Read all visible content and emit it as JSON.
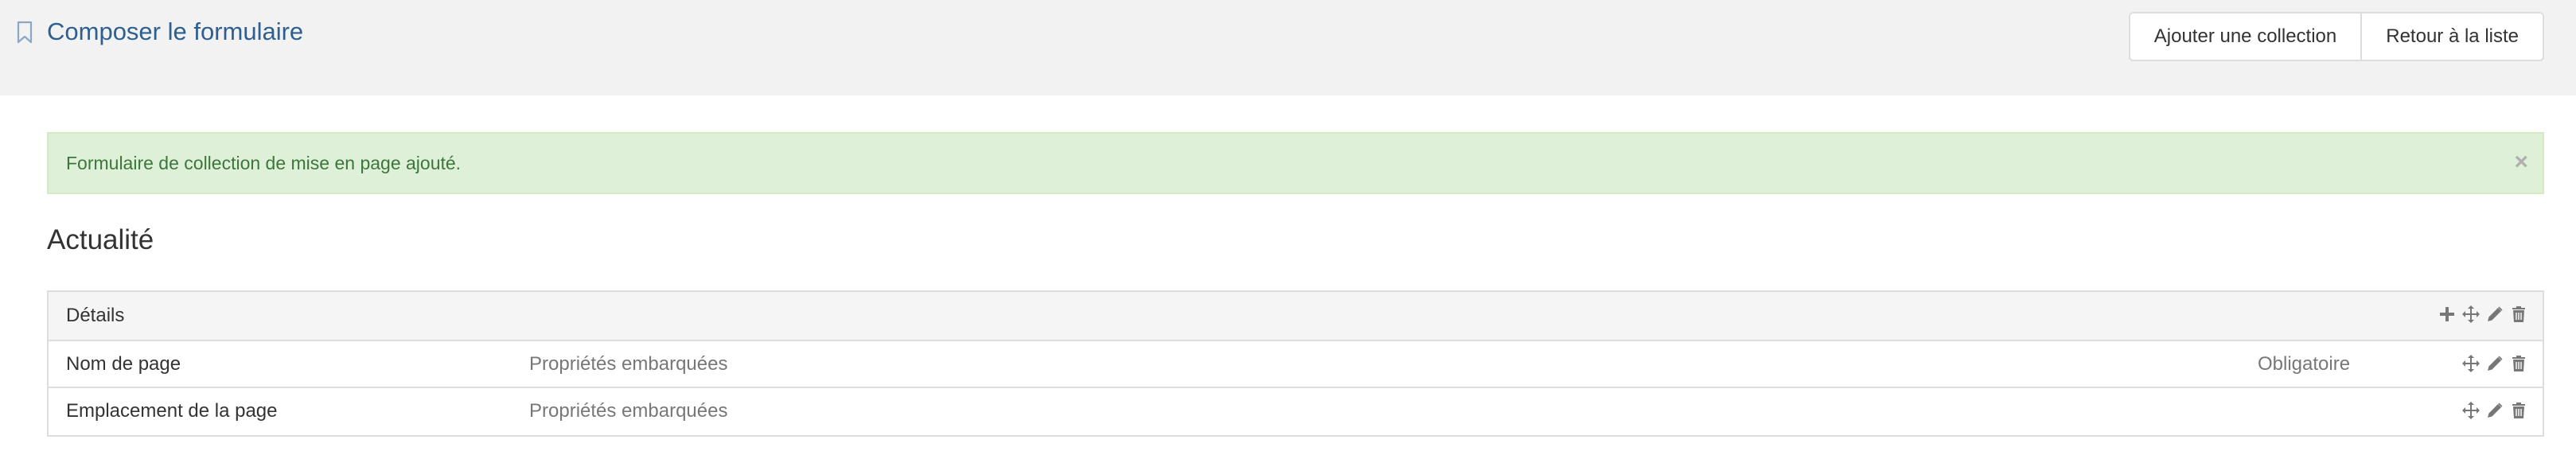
{
  "header": {
    "title": "Composer le formulaire",
    "buttons": {
      "add_collection": "Ajouter une collection",
      "back_to_list": "Retour à la liste"
    }
  },
  "alert": {
    "message": "Formulaire de collection de mise en page ajouté.",
    "close": "×",
    "color": "#3c763d",
    "background": "#dff0d8"
  },
  "section": {
    "title": "Actualité"
  },
  "panel": {
    "heading": "Détails",
    "heading_icons": [
      "plus-icon",
      "move-icon",
      "edit-icon",
      "trash-icon"
    ],
    "rows": [
      {
        "name": "Nom de page",
        "type": "Propriétés embarquées",
        "required": "Obligatoire",
        "icons": [
          "move-icon",
          "edit-icon",
          "trash-icon"
        ]
      },
      {
        "name": "Emplacement de la page",
        "type": "Propriétés embarquées",
        "required": "",
        "icons": [
          "move-icon",
          "edit-icon",
          "trash-icon"
        ]
      }
    ]
  },
  "colors": {
    "title": "#2d5f91",
    "icon": "#777777"
  }
}
